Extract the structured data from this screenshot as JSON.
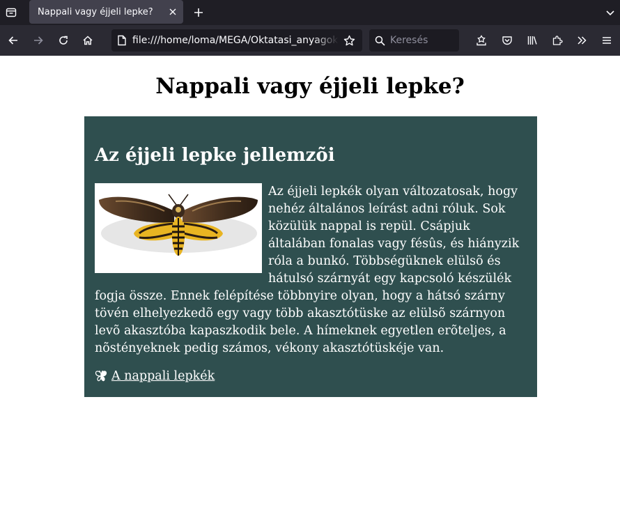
{
  "browser": {
    "tab": {
      "title": "Nappali vagy éjjeli lepke?"
    },
    "url": "file:///home/loma/MEGA/Oktatasi_anyagok/",
    "search_placeholder": "Keresés",
    "icons": {
      "tabs_list": "tabs-list-icon",
      "close_tab": "close-icon",
      "new_tab": "plus-icon",
      "tab_overflow": "chevron-down-icon",
      "back": "back-arrow-icon",
      "forward": "forward-arrow-icon",
      "reload": "reload-icon",
      "home": "home-icon",
      "page": "page-icon",
      "bookmark": "star-icon",
      "search": "search-icon",
      "extensions_toolbar": [
        "save-icon",
        "pocket-icon",
        "library-icon",
        "extensions-icon",
        "overflow-chevrons-icon",
        "menu-icon"
      ]
    }
  },
  "page": {
    "title": "Nappali vagy éjjeli lepke?",
    "card": {
      "heading": "Az éjjeli lepke jellemzõi",
      "body": "Az éjjeli lepkék olyan változatosak, hogy nehéz általános leírást adni róluk. Sok közülük nappal is repül. Csápjuk általában fonalas vagy fésûs, és hiányzik róla a bunkó. Többségüknek elülsõ és hátulsó szárnyát egy kapcsoló készülék fogja össze. Ennek felépítése többnyire olyan, hogy a hátsó szárny tövén elhelyezkedõ egy vagy több akasztótüske az elülsõ szárnyon levõ akasztóba kapaszkodik bele. A hímeknek egyetlen erõteljes, a nõstényeknek pedig számos, vékony akasztótüskéje van.",
      "link_label": "A nappali lepkék",
      "image": "moth-image",
      "link_icon": "butterfly-icon"
    },
    "colors": {
      "card_background": "#2f4f4f",
      "card_text": "#ffffff"
    }
  }
}
